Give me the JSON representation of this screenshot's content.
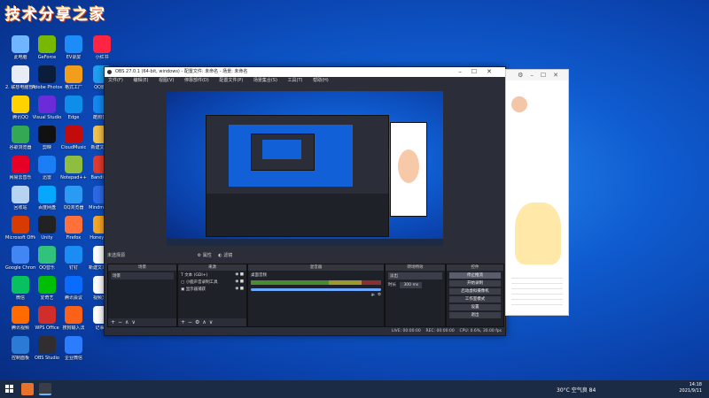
{
  "watermark": "技术分享之家",
  "desktop_icons": [
    {
      "label": "此电脑",
      "color": "#6fb5ff"
    },
    {
      "label": "2. 联想电脑管家",
      "color": "#e8edf5"
    },
    {
      "label": "腾讯QQ",
      "color": "#ffd200"
    },
    {
      "label": "谷歌浏览器",
      "color": "#34a853"
    },
    {
      "label": "网易云音乐",
      "color": "#e60026"
    },
    {
      "label": "回收站",
      "color": "#b7d3ef"
    },
    {
      "label": "Microsoft Office",
      "color": "#d83b01"
    },
    {
      "label": "Google Chrome",
      "color": "#4285f4"
    },
    {
      "label": "微信",
      "color": "#07c160"
    },
    {
      "label": "腾讯视频",
      "color": "#ff6b00"
    },
    {
      "label": "控制面板",
      "color": "#2b7bd6"
    },
    {
      "label": "GeForce",
      "color": "#76b900"
    },
    {
      "label": "Adobe Photoshop",
      "color": "#0a1e3b"
    },
    {
      "label": "Visual Studio",
      "color": "#6a2bd9"
    },
    {
      "label": "剪映",
      "color": "#111111"
    },
    {
      "label": "迅雷",
      "color": "#1b7ef5"
    },
    {
      "label": "百度网盘",
      "color": "#06a7ff"
    },
    {
      "label": "Unity",
      "color": "#222222"
    },
    {
      "label": "QQ音乐",
      "color": "#31c27c"
    },
    {
      "label": "爱奇艺",
      "color": "#00be06"
    },
    {
      "label": "WPS Office",
      "color": "#d12d2a"
    },
    {
      "label": "OBS Studio",
      "color": "#302e31"
    },
    {
      "label": "EV录屏",
      "color": "#1d8cf8"
    },
    {
      "label": "格式工厂",
      "color": "#f29e1b"
    },
    {
      "label": "Edge",
      "color": "#0e8ee9"
    },
    {
      "label": "CloudMusic",
      "color": "#c20c0c"
    },
    {
      "label": "Notepad++",
      "color": "#8fbd3f"
    },
    {
      "label": "QQ浏览器",
      "color": "#2b9af3"
    },
    {
      "label": "Firefox",
      "color": "#ff7139"
    },
    {
      "label": "钉钉",
      "color": "#1c8cf5"
    },
    {
      "label": "腾讯会议",
      "color": "#0a6cff"
    },
    {
      "label": "搜狗输入法",
      "color": "#fb6117"
    },
    {
      "label": "企业微信",
      "color": "#2b7cff"
    },
    {
      "label": "小红书",
      "color": "#ff2442"
    },
    {
      "label": "QQ影音",
      "color": "#1ea0f2"
    },
    {
      "label": "酷狗音乐",
      "color": "#1389f0"
    },
    {
      "label": "新建文件夹",
      "color": "#f2c14a"
    },
    {
      "label": "Bandicam",
      "color": "#e03b2e"
    },
    {
      "label": "Mindmaster",
      "color": "#2e6ae6"
    },
    {
      "label": "Honeyview",
      "color": "#f5a623"
    },
    {
      "label": "新建文本文档",
      "color": "#ffffff"
    },
    {
      "label": "视频文件",
      "color": "#ffffff"
    },
    {
      "label": "记事本",
      "color": "#ffffff"
    }
  ],
  "obs": {
    "title": "OBS 27.0.1 (64-bit, windows) - 配置文件: 未命名 - 场景: 未命名",
    "menu": [
      "文件(F)",
      "编辑(E)",
      "视图(V)",
      "停靠部件(D)",
      "配置文件(P)",
      "场景集合(S)",
      "工具(T)",
      "帮助(H)"
    ],
    "toolbar": {
      "no_source": "未选择源",
      "properties": "属性",
      "filters": "滤镜"
    },
    "docks": {
      "scenes": {
        "title": "场景",
        "items": [
          "场景"
        ]
      },
      "sources": {
        "title": "来源",
        "items": [
          "文本 (GDI+)",
          "小鹿声音录制工具",
          "显示器捕获"
        ]
      },
      "mixer": {
        "title": "混音器",
        "track": "桌面音频",
        "db": "0.0 dB"
      },
      "transitions": {
        "title": "转场特效",
        "type": "淡出",
        "duration_label": "时长",
        "duration": "300 ms"
      },
      "controls": {
        "title": "控件",
        "buttons": [
          "停止推流",
          "开始录制",
          "启动虚拟摄像机",
          "工作室模式",
          "设置",
          "退出"
        ]
      }
    },
    "status": {
      "live": "LIVE: 00:00:00",
      "rec": "REC: 00:00:00",
      "cpu": "CPU: 0.6%, 30.00 fps"
    }
  },
  "taskbar": {
    "weather": "30°C  空气良 84",
    "time": "14:18",
    "date": "2021/9/11"
  }
}
